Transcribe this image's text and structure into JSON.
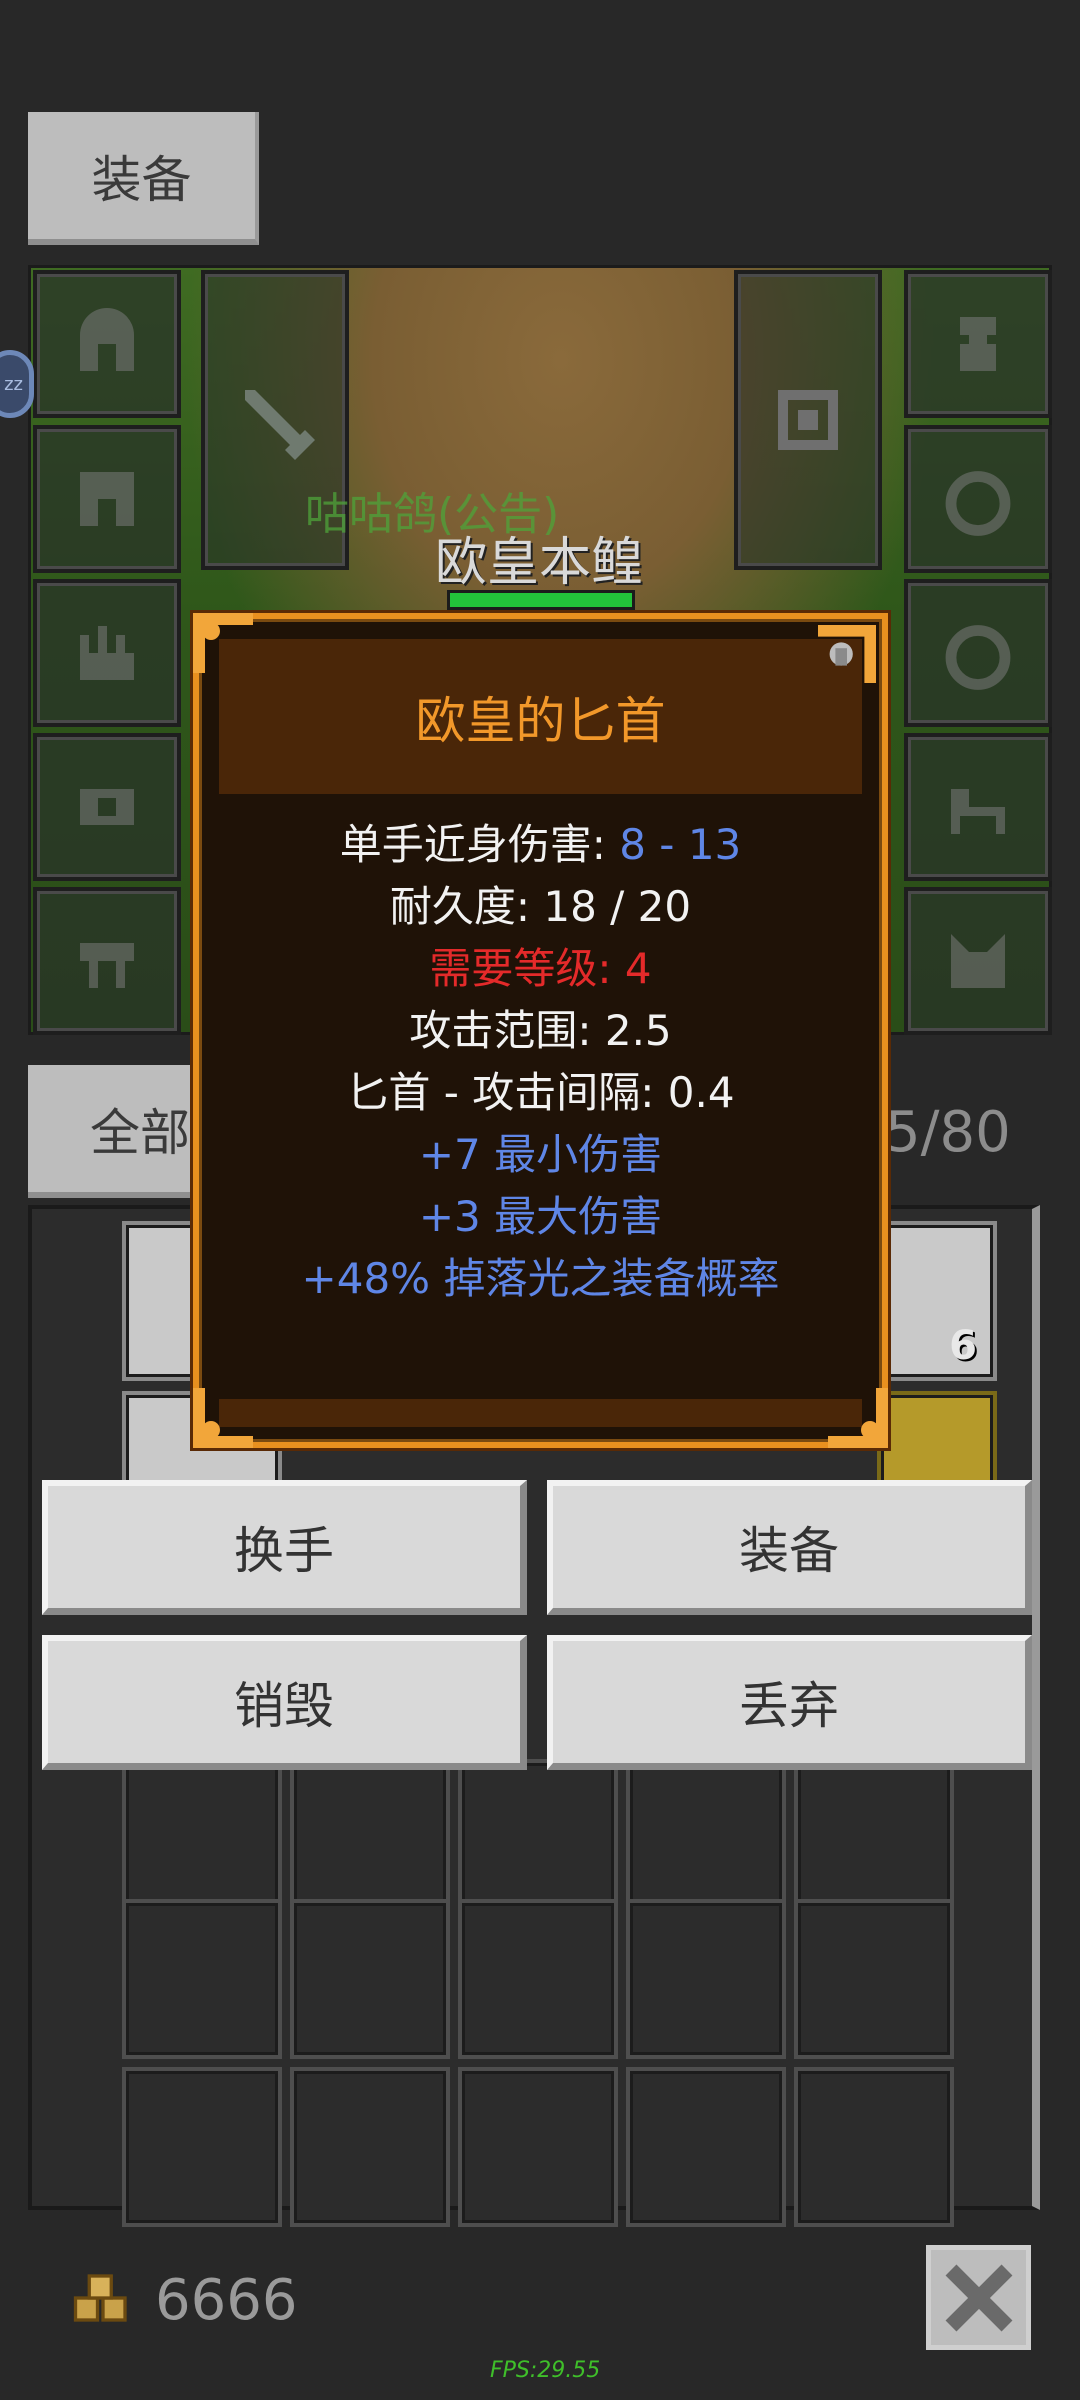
{
  "tabs": {
    "equipment": "装备",
    "all": "全部"
  },
  "scene": {
    "sleep_badge": "zz",
    "announce_name": "咕咕鸽(公告)",
    "player_name": "欧皇本鳇"
  },
  "capacity": "5/80",
  "inventory": {
    "stack_count": "6"
  },
  "tooltip": {
    "title": "欧皇的匕首",
    "damage_label": "单手近身伤害: ",
    "damage_value": "8 - 13",
    "durability": "耐久度: 18 / 20",
    "required_level": "需要等级: 4",
    "attack_range": "攻击范围: 2.5",
    "attack_interval": "匕首 - 攻击间隔: 0.4",
    "bonus_min_damage": "+7 最小伤害",
    "bonus_max_damage": "+3 最大伤害",
    "bonus_drop": "+48% 掉落光之装备概率"
  },
  "actions": {
    "swap_hand": "换手",
    "equip": "装备",
    "destroy": "销毁",
    "discard": "丢弃"
  },
  "footer": {
    "gold": "6666",
    "fps": "FPS:29.55"
  },
  "colors": {
    "tooltip_title": "#f2982a",
    "stat_bonus": "#5f86e6",
    "stat_warning": "#e42a2a",
    "tooltip_border": "#e8901f"
  }
}
